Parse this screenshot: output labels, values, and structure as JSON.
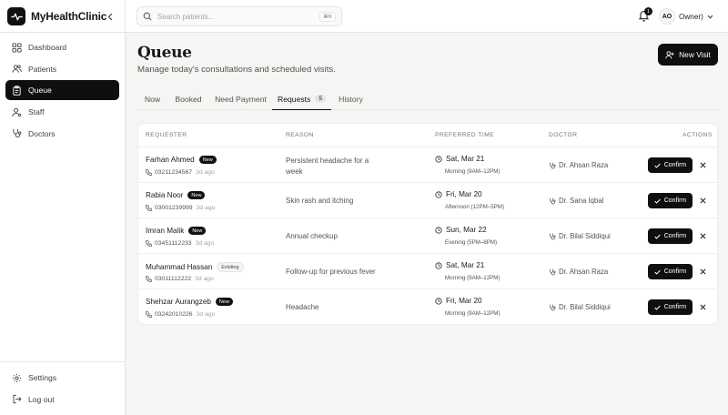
{
  "brand": {
    "name": "MyHealthClinic",
    "logo_icon": "heartbeat-icon"
  },
  "sidebar": {
    "items": [
      {
        "label": "Dashboard",
        "icon": "grid-icon"
      },
      {
        "label": "Patients",
        "icon": "users-icon"
      },
      {
        "label": "Queue",
        "icon": "clipboard-icon",
        "active": true
      },
      {
        "label": "Staff",
        "icon": "staff-icon"
      },
      {
        "label": "Doctors",
        "icon": "stethoscope-icon"
      }
    ],
    "bottom": [
      {
        "label": "Settings",
        "icon": "gear-icon"
      },
      {
        "label": "Log out",
        "icon": "logout-icon"
      }
    ]
  },
  "topbar": {
    "search_placeholder": "Search patients...",
    "search_shortcut": "⌘K",
    "notification_count": "1",
    "user_initials": "AO",
    "user_role": "Owner)"
  },
  "page": {
    "title": "Queue",
    "subtitle": "Manage today's consultations and scheduled visits.",
    "new_visit_label": "New Visit"
  },
  "tabs": [
    {
      "label": "Now"
    },
    {
      "label": "Booked"
    },
    {
      "label": "Need Payment"
    },
    {
      "label": "Requests",
      "count": "5",
      "active": true
    },
    {
      "label": "History"
    }
  ],
  "table": {
    "headers": {
      "requester": "REQUESTER",
      "reason": "REASON",
      "preferred_time": "PREFERRED TIME",
      "doctor": "DOCTOR",
      "actions": "ACTIONS"
    },
    "confirm_label": "Confirm",
    "rows": [
      {
        "name": "Farhan Ahmed",
        "badge": "New",
        "phone": "03211234567",
        "ago": "3d ago",
        "reason": "Persistent headache for a week",
        "date": "Sat, Mar 21",
        "slot": "Morning (9AM–12PM)",
        "doctor": "Dr. Ahsan Raza"
      },
      {
        "name": "Rabia Noor",
        "badge": "New",
        "phone": "03001239999",
        "ago": "3d ago",
        "reason": "Skin rash and itching",
        "date": "Fri, Mar 20",
        "slot": "Afternoon (12PM–5PM)",
        "doctor": "Dr. Sana Iqbal"
      },
      {
        "name": "Imran Malik",
        "badge": "New",
        "phone": "03451112233",
        "ago": "3d ago",
        "reason": "Annual checkup",
        "date": "Sun, Mar 22",
        "slot": "Evening (5PM–8PM)",
        "doctor": "Dr. Bilal Siddiqui"
      },
      {
        "name": "Muhammad Hassan",
        "badge": "Existing",
        "phone": "03011112222",
        "ago": "3d ago",
        "reason": "Follow-up for previous fever",
        "date": "Sat, Mar 21",
        "slot": "Morning (9AM–12PM)",
        "doctor": "Dr. Ahsan Raza"
      },
      {
        "name": "Shehzar Aurangzeb",
        "badge": "New",
        "phone": "03242010226",
        "ago": "3d ago",
        "reason": "Headache",
        "date": "Fri, Mar 20",
        "slot": "Morning (9AM–12PM)",
        "doctor": "Dr. Bilal Siddiqui"
      }
    ]
  }
}
